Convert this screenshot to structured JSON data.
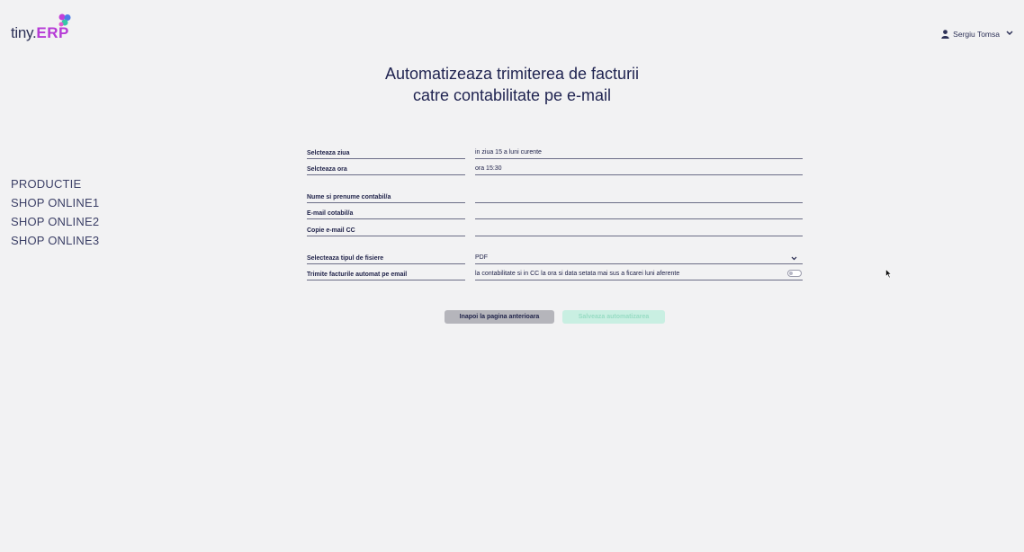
{
  "header": {
    "logo_text_main": "tiny.",
    "logo_text_brand": "ERP",
    "user_name": "Sergiu Tomsa"
  },
  "title": {
    "line1": "Automatizeaza trimiterea de facturii",
    "line2": "catre contabilitate pe e-mail"
  },
  "sidebar": {
    "items": [
      {
        "label": "PRODUCTIE"
      },
      {
        "label": "SHOP ONLINE1"
      },
      {
        "label": "SHOP ONLINE2"
      },
      {
        "label": "SHOP ONLINE3"
      }
    ]
  },
  "form": {
    "day": {
      "label": "Selcteaza ziua",
      "value": "in ziua 15 a luni curente"
    },
    "hour": {
      "label": "Selcteaza ora",
      "value": "ora 15:30"
    },
    "accountant_name": {
      "label": "Nume si prenume contabil/a",
      "value": ""
    },
    "accountant_email": {
      "label": "E-mail cotabil/a",
      "value": ""
    },
    "cc_email": {
      "label": "Copie e-mail CC",
      "value": ""
    },
    "file_type": {
      "label": "Selecteaza tipul de fisiere",
      "value": "PDF"
    },
    "auto_send": {
      "label": "Trimite facturile automat pe email",
      "value": "la contabilitate si in CC la ora si data setata mai sus a ficarei luni aferente",
      "enabled": false
    }
  },
  "buttons": {
    "back": "Inapoi la pagina anterioara",
    "save": "Salveaza automatizarea"
  },
  "colors": {
    "background": "#f2f2f3",
    "brand_purple": "#b63bd6",
    "save_button_bg": "#c9efe2",
    "back_button_bg": "#b5b5bb"
  }
}
